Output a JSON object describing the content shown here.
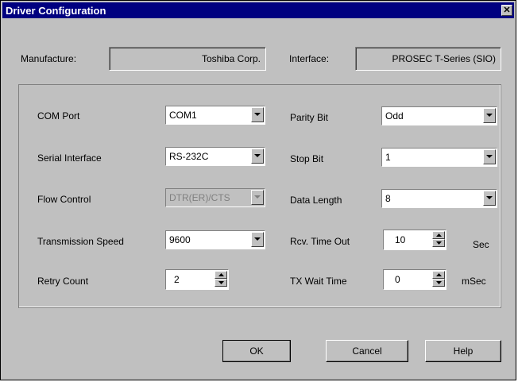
{
  "window": {
    "title": "Driver Configuration",
    "close": "✕"
  },
  "header": {
    "manufacture_label": "Manufacture:",
    "manufacture_value": "Toshiba Corp.",
    "interface_label": "Interface:",
    "interface_value": "PROSEC T-Series (SIO)"
  },
  "left": {
    "com_port_label": "COM Port",
    "com_port_value": "COM1",
    "serial_label": "Serial Interface",
    "serial_value": "RS-232C",
    "flow_label": "Flow Control",
    "flow_value": "DTR(ER)/CTS",
    "speed_label": "Transmission Speed",
    "speed_value": "9600",
    "retry_label": "Retry Count",
    "retry_value": "2"
  },
  "right": {
    "parity_label": "Parity Bit",
    "parity_value": "Odd",
    "stop_label": "Stop Bit",
    "stop_value": "1",
    "data_len_label": "Data Length",
    "data_len_value": "8",
    "rcv_label": "Rcv. Time Out",
    "rcv_value": "10",
    "rcv_unit": "Sec",
    "tx_label": "TX Wait Time",
    "tx_value": "0",
    "tx_unit": "mSec"
  },
  "buttons": {
    "ok": "OK",
    "cancel": "Cancel",
    "help": "Help"
  }
}
